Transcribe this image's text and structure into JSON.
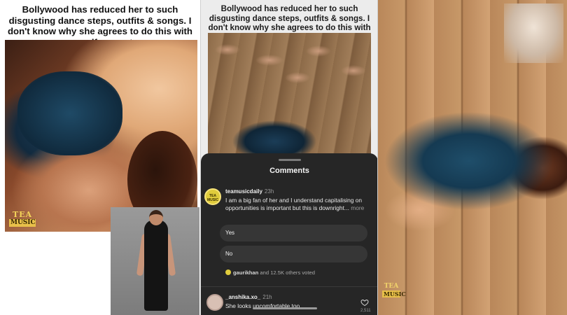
{
  "left_panel": {
    "headline": "Bollywood has reduced her to such disgusting dance steps, outfits & songs. I don't know why she agrees to do this with no self respect",
    "logo_top": "TEA",
    "logo_bottom": "MUSIC"
  },
  "middle_panel": {
    "headline": "Bollywood has reduced her to such disgusting dance steps, outfits & songs. I don't know why she agrees to do this with no self respect",
    "comments_sheet": {
      "title": "Comments",
      "comments": [
        {
          "username": "teamusicdaily",
          "time": "23h",
          "avatar_text": "TEA MUSIC",
          "text": "I am a big fan of her and I understand capitalising on opportunities is important but this is downright...",
          "more_label": "more"
        },
        {
          "username": "_anshika.xo_",
          "time": "21h",
          "text": "She looks uncomfortable too",
          "likes": "2,511"
        }
      ],
      "poll": {
        "options": [
          "Yes",
          "No"
        ],
        "voted_name": "gaurikhan",
        "voted_rest": "and 12.5K others voted"
      }
    }
  },
  "right_panel": {
    "logo_top": "TEA",
    "logo_bottom": "MUSIC"
  },
  "colors": {
    "sheet_bg": "#262626",
    "poll_option_bg": "#363636",
    "logo_gold": "#e8c04a"
  },
  "icons": [
    "heart-icon"
  ]
}
